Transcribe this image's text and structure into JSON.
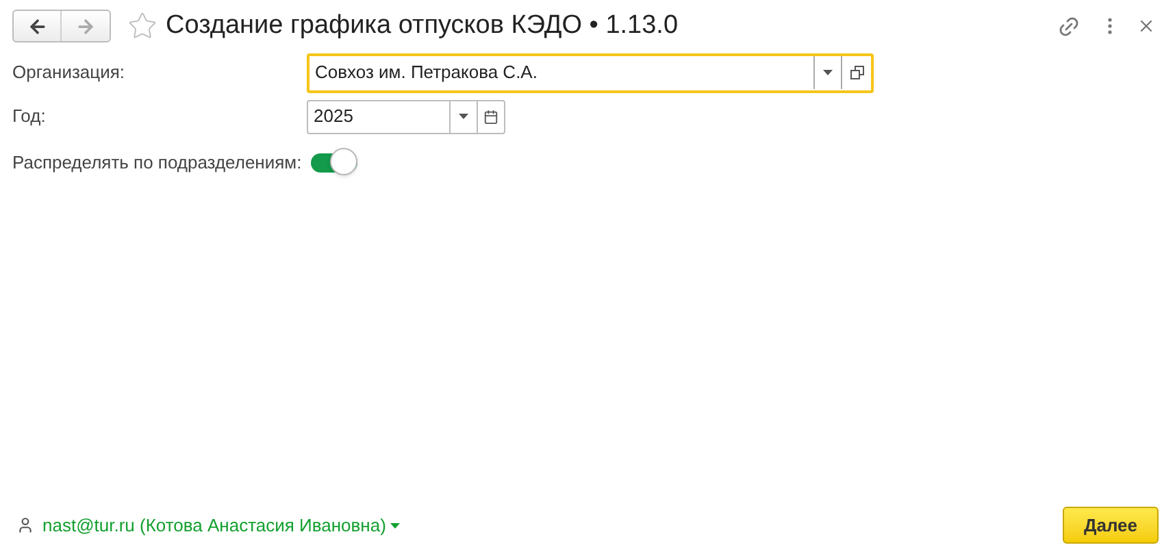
{
  "window": {
    "title": "Создание графика отпусков КЭДО • 1.13.0",
    "favorite": false
  },
  "form": {
    "organization": {
      "label": "Организация:",
      "value": "Совхоз им. Петракова С.А.",
      "focused": true
    },
    "year": {
      "label": "Год:",
      "value": "2025"
    },
    "distribute": {
      "label": "Распределять по подразделениям:",
      "on": true
    }
  },
  "footer": {
    "user": "nast@tur.ru (Котова Анастасия Ивановна)",
    "button": "Далее"
  }
}
